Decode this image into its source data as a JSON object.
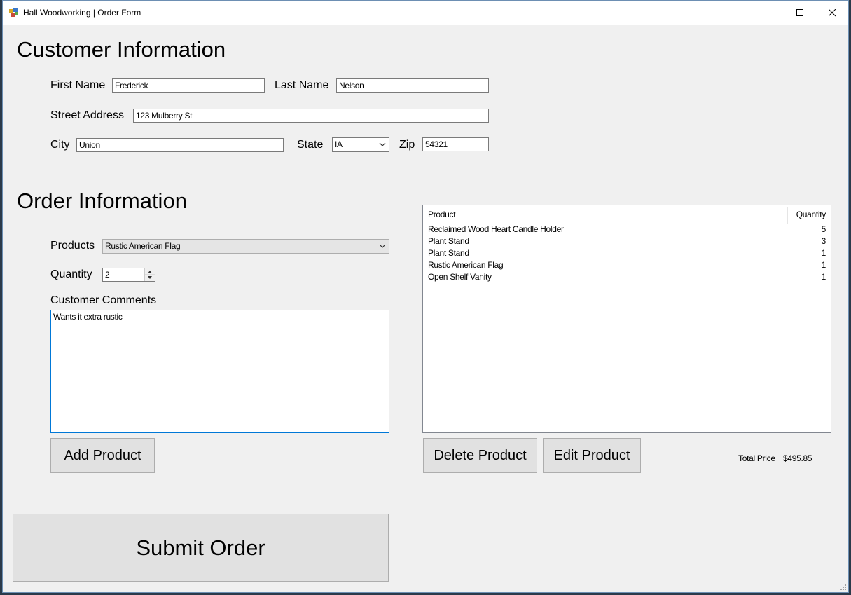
{
  "window": {
    "title": "Hall Woodworking | Order Form"
  },
  "customer": {
    "heading": "Customer Information",
    "first_name_label": "First Name",
    "first_name_value": "Frederick",
    "last_name_label": "Last Name",
    "last_name_value": "Nelson",
    "street_label": "Street Address",
    "street_value": "123 Mulberry St",
    "city_label": "City",
    "city_value": "Union",
    "state_label": "State",
    "state_value": "IA",
    "zip_label": "Zip",
    "zip_value": "54321"
  },
  "order": {
    "heading": "Order Information",
    "products_label": "Products",
    "products_value": "Rustic American Flag",
    "quantity_label": "Quantity",
    "quantity_value": "2",
    "comments_label": "Customer Comments",
    "comments_value": "Wants it extra rustic",
    "add_button": "Add Product",
    "delete_button": "Delete Product",
    "edit_button": "Edit Product",
    "submit_button": "Submit Order",
    "total_label": "Total Price",
    "total_value": "$495.85"
  },
  "order_list": {
    "columns": [
      "Product",
      "Quantity"
    ],
    "rows": [
      {
        "product": "Reclaimed Wood Heart Candle Holder",
        "quantity": "5"
      },
      {
        "product": "Plant Stand",
        "quantity": "3"
      },
      {
        "product": "Plant Stand",
        "quantity": "1"
      },
      {
        "product": "Rustic American Flag",
        "quantity": "1"
      },
      {
        "product": "Open Shelf Vanity",
        "quantity": "1"
      }
    ]
  },
  "icons": {
    "app": "app-icon",
    "minimize": "minimize-icon",
    "maximize": "maximize-icon",
    "close": "close-icon",
    "dropdown": "chevron-down-icon",
    "spinner": "spinner-arrows-icon"
  }
}
